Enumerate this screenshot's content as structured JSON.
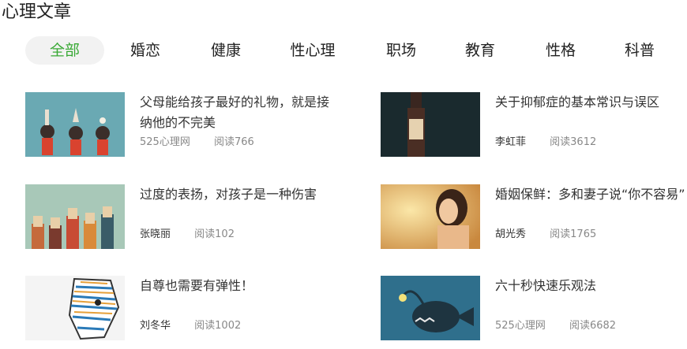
{
  "header": {
    "title": "心理文章"
  },
  "tabs": [
    {
      "label": "全部"
    },
    {
      "label": "婚恋"
    },
    {
      "label": "健康"
    },
    {
      "label": "性心理"
    },
    {
      "label": "职场"
    },
    {
      "label": "教育"
    },
    {
      "label": "性格"
    },
    {
      "label": "科普"
    }
  ],
  "articles": [
    {
      "title": "父母能给孩子最好的礼物，就是接纳他的不完美",
      "author": "525心理网",
      "reads": "阅读766"
    },
    {
      "title": "关于抑郁症的基本常识与误区",
      "author": "李虹菲",
      "reads": "阅读3612"
    },
    {
      "title": "过度的表扬，对孩子是一种伤害",
      "author": "张晓丽",
      "reads": "阅读102"
    },
    {
      "title": "婚姻保鲜：多和妻子说“你不容易”",
      "author": "胡光秀",
      "reads": "阅读1765"
    },
    {
      "title": "自尊也需要有弹性！",
      "author": "刘冬华",
      "reads": "阅读1002"
    },
    {
      "title": "六十秒快速乐观法",
      "author": "525心理网",
      "reads": "阅读6682"
    }
  ]
}
